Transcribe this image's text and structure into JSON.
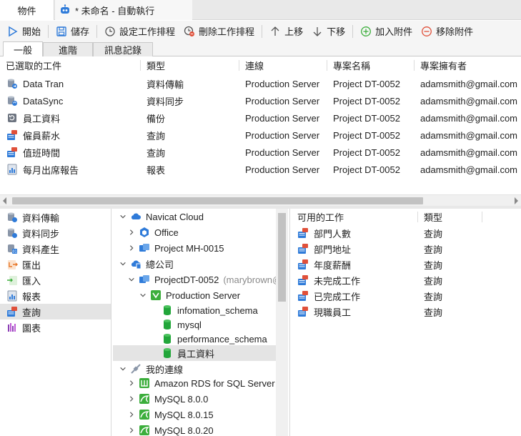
{
  "tabs": {
    "objects": "物件",
    "automation": "* 未命名 - 自動執行"
  },
  "toolbar": {
    "start": "開始",
    "save": "儲存",
    "set_schedule": "設定工作排程",
    "delete_schedule": "刪除工作排程",
    "move_up": "上移",
    "move_down": "下移",
    "add_attachment": "加入附件",
    "remove_attachment": "移除附件"
  },
  "subtabs": [
    "一般",
    "進階",
    "訊息記錄"
  ],
  "selected_tasks": {
    "headers": [
      "已選取的工件",
      "類型",
      "連線",
      "專案名稱",
      "專案擁有者"
    ],
    "rows": [
      {
        "icon": "data-transfer-icon",
        "name": "Data Tran",
        "type": "資料傳輸",
        "connection": "Production Server",
        "project": "Project DT-0052",
        "owner": "adamsmith@gmail.com"
      },
      {
        "icon": "data-sync-icon",
        "name": "DataSync",
        "type": "資料同步",
        "connection": "Production Server",
        "project": "Project DT-0052",
        "owner": "adamsmith@gmail.com"
      },
      {
        "icon": "backup-icon",
        "name": "員工資料",
        "type": "備份",
        "connection": "Production Server",
        "project": "Project DT-0052",
        "owner": "adamsmith@gmail.com"
      },
      {
        "icon": "query-icon",
        "name": "僱員薪水",
        "type": "查詢",
        "connection": "Production Server",
        "project": "Project DT-0052",
        "owner": "adamsmith@gmail.com"
      },
      {
        "icon": "query-icon",
        "name": "值班時間",
        "type": "查詢",
        "connection": "Production Server",
        "project": "Project DT-0052",
        "owner": "adamsmith@gmail.com"
      },
      {
        "icon": "report-icon",
        "name": "每月出席報告",
        "type": "報表",
        "connection": "Production Server",
        "project": "Project DT-0052",
        "owner": "adamsmith@gmail.com"
      }
    ]
  },
  "categories": [
    {
      "label": "資料傳輸",
      "icon": "data-transfer-icon"
    },
    {
      "label": "資料同步",
      "icon": "data-sync-icon"
    },
    {
      "label": "資料產生",
      "icon": "data-generation-icon"
    },
    {
      "label": "匯出",
      "icon": "export-icon"
    },
    {
      "label": "匯入",
      "icon": "import-icon"
    },
    {
      "label": "報表",
      "icon": "report-icon"
    },
    {
      "label": "查詢",
      "icon": "query-icon",
      "selected": true
    },
    {
      "label": "圖表",
      "icon": "chart-icon"
    }
  ],
  "tree": [
    {
      "label": "Navicat Cloud",
      "icon": "cloud-icon",
      "expanded": true
    },
    {
      "label": "Office",
      "icon": "project-icon",
      "expanded": false
    },
    {
      "label": "Project MH-0015",
      "icon": "project-icon",
      "expanded": false
    },
    {
      "label": "總公司",
      "icon": "cloud-icon",
      "expanded": true
    },
    {
      "label": "ProjectDT-0052",
      "note": "(marybrown@",
      "icon": "project-icon",
      "expanded": true
    },
    {
      "label": "Production Server",
      "icon": "server-icon",
      "expanded": true
    },
    {
      "label": "infomation_schema",
      "icon": "database-icon"
    },
    {
      "label": "mysql",
      "icon": "database-icon"
    },
    {
      "label": "performance_schema",
      "icon": "database-icon"
    },
    {
      "label": "員工資料",
      "icon": "database-icon",
      "selected": true
    },
    {
      "label": "我的連線",
      "icon": "connection-icon",
      "expanded": true
    },
    {
      "label": "Amazon RDS for SQL Server",
      "icon": "server-icon",
      "expanded": false
    },
    {
      "label": "MySQL 8.0.0",
      "icon": "mysql-icon",
      "expanded": false
    },
    {
      "label": "MySQL 8.0.15",
      "icon": "mysql-icon",
      "expanded": false
    },
    {
      "label": "MySQL 8.0.20",
      "icon": "mysql-icon",
      "expanded": false
    }
  ],
  "available_tasks": {
    "headers": [
      "可用的工作",
      "類型"
    ],
    "rows": [
      {
        "name": "部門人數",
        "type": "查詢"
      },
      {
        "name": "部門地址",
        "type": "查詢"
      },
      {
        "name": "年度薪酬",
        "type": "查詢"
      },
      {
        "name": "未完成工作",
        "type": "查詢"
      },
      {
        "name": "已完成工作",
        "type": "查詢"
      },
      {
        "name": "現職員工",
        "type": "查詢"
      }
    ]
  },
  "colors": {
    "accent_blue": "#2f7bd9",
    "green": "#3cae3c",
    "red": "#e0503a",
    "selection": "#e4e4e4"
  }
}
